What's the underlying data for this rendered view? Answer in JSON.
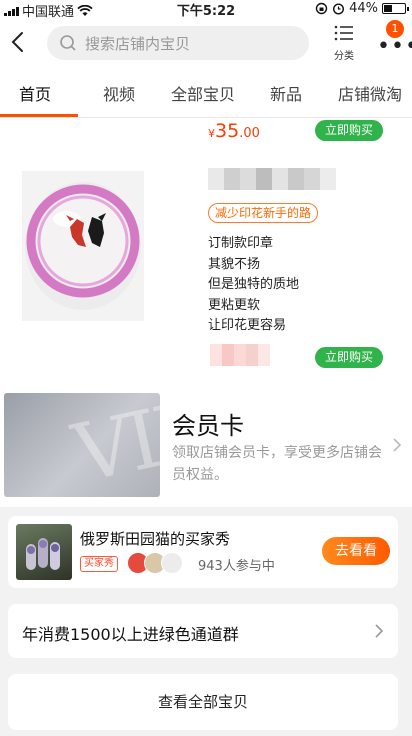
{
  "status_bar": {
    "carrier": "中国联通",
    "time": "下午5:22",
    "battery_percent": "44%",
    "battery_level": 0.44
  },
  "header": {
    "search_placeholder": "搜索店铺内宝贝",
    "category_label": "分类",
    "more_badge": "1"
  },
  "tabs": [
    {
      "label": "首页",
      "active": true
    },
    {
      "label": "视频"
    },
    {
      "label": "全部宝贝"
    },
    {
      "label": "新品"
    },
    {
      "label": "店铺微淘"
    }
  ],
  "product": {
    "price_currency": "¥",
    "price_integer": "35",
    "price_decimal": ".00",
    "buy_label": "立即购买",
    "tag": "减少印花新手的路",
    "description": [
      "订制款印章",
      "其貌不扬",
      "但是独特的质地",
      "更粘更软",
      "让印花更容易"
    ],
    "buy_label_bottom": "立即购买"
  },
  "member_card": {
    "title": "会员卡",
    "subtitle": "领取店铺会员卡，享受更多店铺会员权益。",
    "image_text": "VIP"
  },
  "buyer_show": {
    "title": "俄罗斯田园猫的买家秀",
    "tag": "买家秀",
    "participants": "943人参与中",
    "button": "去看看"
  },
  "green_channel": {
    "text": "年消费1500以上进绿色通道群"
  },
  "all_items": {
    "text": "查看全部宝贝"
  },
  "colors": {
    "accent": "#ff5000",
    "green_button": "#2fb34a",
    "price": "#ff3c00"
  }
}
